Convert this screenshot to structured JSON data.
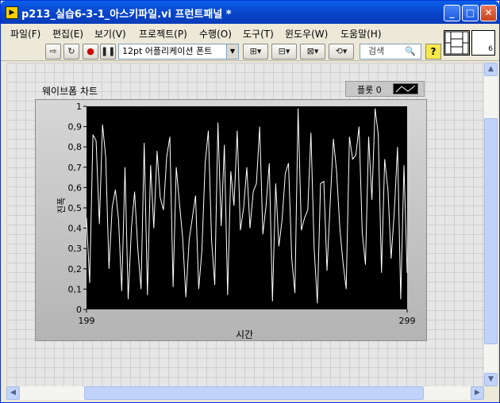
{
  "window": {
    "title": "p213_실습6-3-1_아스키파일.vi 프런트패널 *",
    "app_icon": "labview-run-icon",
    "buttons": {
      "minimize": "_",
      "maximize": "□",
      "close": "✕"
    }
  },
  "menu": [
    "파일(F)",
    "편집(E)",
    "보기(V)",
    "프로젝트(P)",
    "수행(O)",
    "도구(T)",
    "윈도우(W)",
    "도움말(H)"
  ],
  "toolbar": {
    "font": "12pt 어플리케이션 폰트",
    "search_placeholder": "검색",
    "help": "?",
    "vi_icon_number": "6"
  },
  "chart": {
    "label": "웨이브폼 차트",
    "legend_plot": "플롯 0",
    "xlabel": "시간",
    "ylabel": "진폭"
  },
  "colors": {
    "plot_bg": "#000000",
    "trace": "#ffffff",
    "panel_grid": "#cfcfcf"
  },
  "chart_data": {
    "type": "line",
    "xlabel": "시간",
    "ylabel": "진폭",
    "xlim": [
      199,
      299
    ],
    "ylim": [
      0,
      1
    ],
    "x_ticks": [
      "199",
      "299"
    ],
    "y_ticks": [
      "0",
      "0,1",
      "0,2",
      "0,3",
      "0,4",
      "0,5",
      "0,6",
      "0,7",
      "0,8",
      "0,9",
      "1"
    ],
    "grid": false,
    "series": [
      {
        "name": "플롯 0",
        "x_start": 199,
        "values": [
          0.45,
          0.13,
          0.86,
          0.83,
          0.42,
          0.91,
          0.75,
          0.2,
          0.5,
          0.59,
          0.44,
          0.09,
          0.7,
          0.05,
          0.4,
          0.58,
          0.3,
          0.1,
          0.82,
          0.07,
          0.71,
          0.4,
          0.78,
          0.55,
          0.49,
          0.75,
          0.85,
          0.11,
          0.7,
          0.52,
          0.35,
          0.06,
          0.34,
          0.45,
          0.56,
          0.1,
          0.29,
          0.72,
          0.88,
          0.34,
          0.12,
          0.92,
          0.41,
          0.81,
          0.07,
          0.68,
          0.51,
          0.88,
          0.39,
          0.5,
          0.7,
          0.4,
          0.58,
          0.62,
          0.9,
          0.37,
          0.51,
          0.72,
          0.04,
          0.62,
          0.31,
          0.44,
          0.67,
          0.72,
          0.25,
          0.08,
          0.99,
          0.39,
          0.45,
          0.49,
          0.87,
          0.3,
          0.03,
          0.62,
          0.63,
          0.19,
          0.52,
          0.84,
          0.68,
          0.4,
          0.23,
          0.1,
          0.85,
          0.74,
          0.76,
          0.9,
          0.38,
          0.22,
          0.85,
          0.54,
          0.99,
          0.86,
          0.18,
          0.74,
          0.59,
          0.25,
          0.48,
          0.8,
          0.05,
          0.71,
          0.18
        ]
      }
    ]
  }
}
